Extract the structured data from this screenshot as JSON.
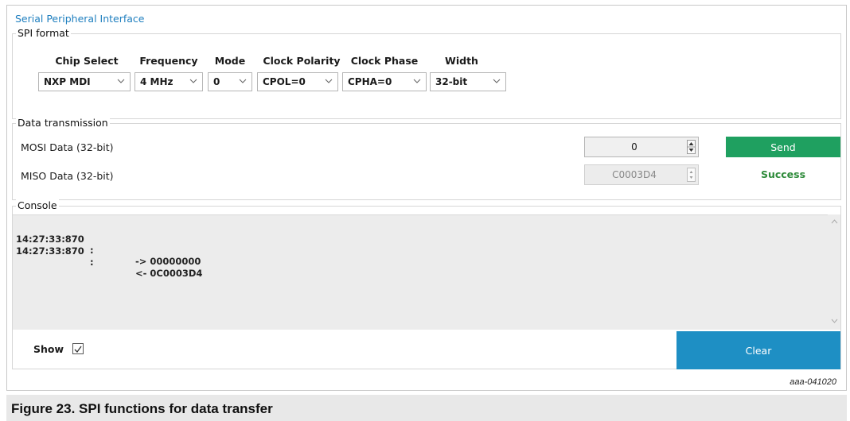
{
  "app_title": "Serial Peripheral Interface",
  "spi_format": {
    "legend": "SPI format",
    "fields": [
      {
        "label": "Chip Select",
        "value": "NXP MDI"
      },
      {
        "label": "Frequency",
        "value": "4 MHz"
      },
      {
        "label": "Mode",
        "value": "0"
      },
      {
        "label": "Clock Polarity",
        "value": "CPOL=0"
      },
      {
        "label": "Clock Phase",
        "value": "CPHA=0"
      },
      {
        "label": "Width",
        "value": "32-bit"
      }
    ]
  },
  "data_transmission": {
    "legend": "Data transmission",
    "mosi_label": "MOSI Data (32-bit)",
    "mosi_value": "0",
    "miso_label": "MISO Data (32-bit)",
    "miso_value": "C0003D4",
    "send_label": "Send",
    "status": "Success"
  },
  "console": {
    "legend": "Console",
    "lines": [
      {
        "timestamp": "14:27:33:870",
        "sep": ":",
        "message": "-> 00000000"
      },
      {
        "timestamp": "14:27:33:870",
        "sep": ":",
        "message": "<- 0C0003D4"
      }
    ],
    "show_label": "Show",
    "show_checked": true,
    "clear_label": "Clear"
  },
  "figure_id": "aaa-041020",
  "caption": "Figure 23.  SPI functions for data transfer",
  "colors": {
    "title_blue": "#1f7fbf",
    "send_green": "#1fa060",
    "success_green": "#2e8b3a",
    "clear_blue": "#1e8fc4"
  },
  "icons": [
    "chevron-down-icon",
    "spin-up-icon",
    "spin-down-icon",
    "scroll-up-icon",
    "scroll-down-icon",
    "checkbox-check-icon"
  ]
}
